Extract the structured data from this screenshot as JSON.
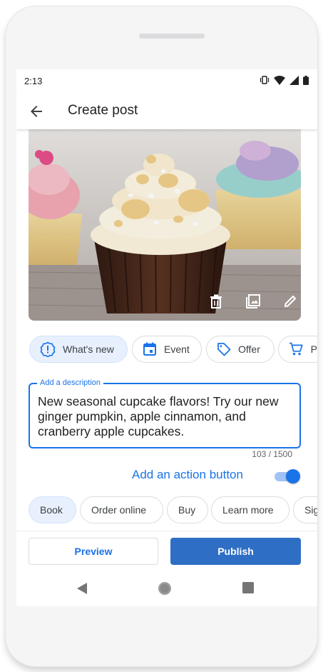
{
  "status_bar": {
    "time": "2:13",
    "icons": [
      "vibrate-icon",
      "wifi-icon",
      "signal-icon",
      "battery-icon"
    ]
  },
  "app_bar": {
    "back_icon": "arrow-back-icon",
    "title": "Create post"
  },
  "photo": {
    "subject": "cupcake",
    "actions": [
      "delete-icon",
      "gallery-icon",
      "edit-icon"
    ]
  },
  "post_types": [
    {
      "label": "What's new",
      "icon": "alert-circle-icon",
      "selected": true
    },
    {
      "label": "Event",
      "icon": "calendar-icon",
      "selected": false
    },
    {
      "label": "Offer",
      "icon": "tag-icon",
      "selected": false
    },
    {
      "label": "P",
      "icon": "cart-icon",
      "selected": false
    }
  ],
  "description": {
    "label": "Add a description",
    "value": "New seasonal cupcake flavors! Try our new ginger pumpkin, apple cinnamon, and cranberry apple cupcakes.",
    "counter": "103 / 1500"
  },
  "action_button": {
    "label": "Add an action button",
    "enabled": true
  },
  "action_types": [
    {
      "label": "Book",
      "selected": true
    },
    {
      "label": "Order online",
      "selected": false
    },
    {
      "label": "Buy",
      "selected": false
    },
    {
      "label": "Learn more",
      "selected": false
    },
    {
      "label": "Sig",
      "selected": false
    }
  ],
  "buttons": {
    "preview": "Preview",
    "publish": "Publish"
  },
  "nav": [
    "back-triangle-icon",
    "home-circle-icon",
    "recents-square-icon"
  ],
  "colors": {
    "accent": "#1a73e8",
    "publish": "#2f6ec5",
    "chip_selected": "#e8f0fe"
  }
}
